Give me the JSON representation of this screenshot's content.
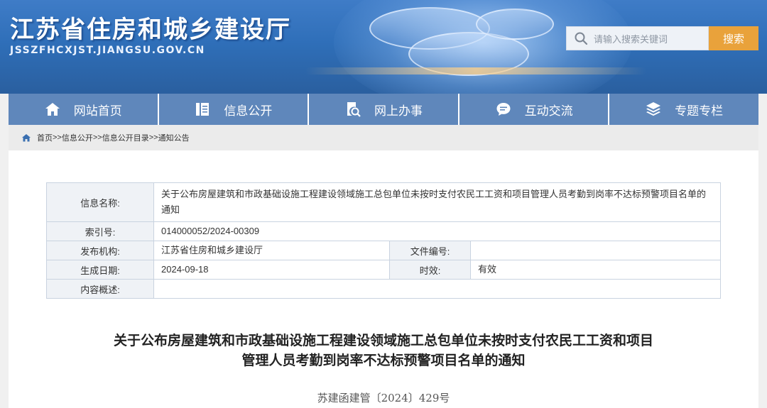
{
  "header": {
    "site_title": "江苏省住房和城乡建设厅",
    "site_url": "JSSZFHCXJST.JIANGSU.GOV.CN",
    "search_placeholder": "请输入搜索关键词",
    "search_button": "搜索"
  },
  "nav": {
    "items": [
      {
        "label": "网站首页",
        "icon": "home-icon"
      },
      {
        "label": "信息公开",
        "icon": "document-icon"
      },
      {
        "label": "网上办事",
        "icon": "search-doc-icon"
      },
      {
        "label": "互动交流",
        "icon": "chat-icon"
      },
      {
        "label": "专题专栏",
        "icon": "layers-icon"
      }
    ]
  },
  "breadcrumb": {
    "items": [
      "首页",
      "信息公开",
      "信息公开目录",
      "通知公告"
    ],
    "separator": ">>"
  },
  "info_table": {
    "name_label": "信息名称:",
    "name_value": "关于公布房屋建筑和市政基础设施工程建设领域施工总包单位未按时支付农民工工资和项目管理人员考勤到岗率不达标预警项目名单的通知",
    "index_label": "索引号:",
    "index_value": "014000052/2024-00309",
    "publisher_label": "发布机构:",
    "publisher_value": "江苏省住房和城乡建设厅",
    "file_no_label": "文件编号:",
    "file_no_value": "",
    "date_label": "生成日期:",
    "date_value": "2024-09-18",
    "validity_label": "时效:",
    "validity_value": "有效",
    "summary_label": "内容概述:",
    "summary_value": ""
  },
  "document": {
    "title_line1": "关于公布房屋建筑和市政基础设施工程建设领域施工总包单位未按时支付农民工工资和项目",
    "title_line2": "管理人员考勤到岗率不达标预警项目名单的通知",
    "doc_number": "苏建函建管〔2024〕429号"
  },
  "colors": {
    "nav_bg": "#5f87bb",
    "search_button": "#e9a23b",
    "banner": "#2f6fb9"
  }
}
